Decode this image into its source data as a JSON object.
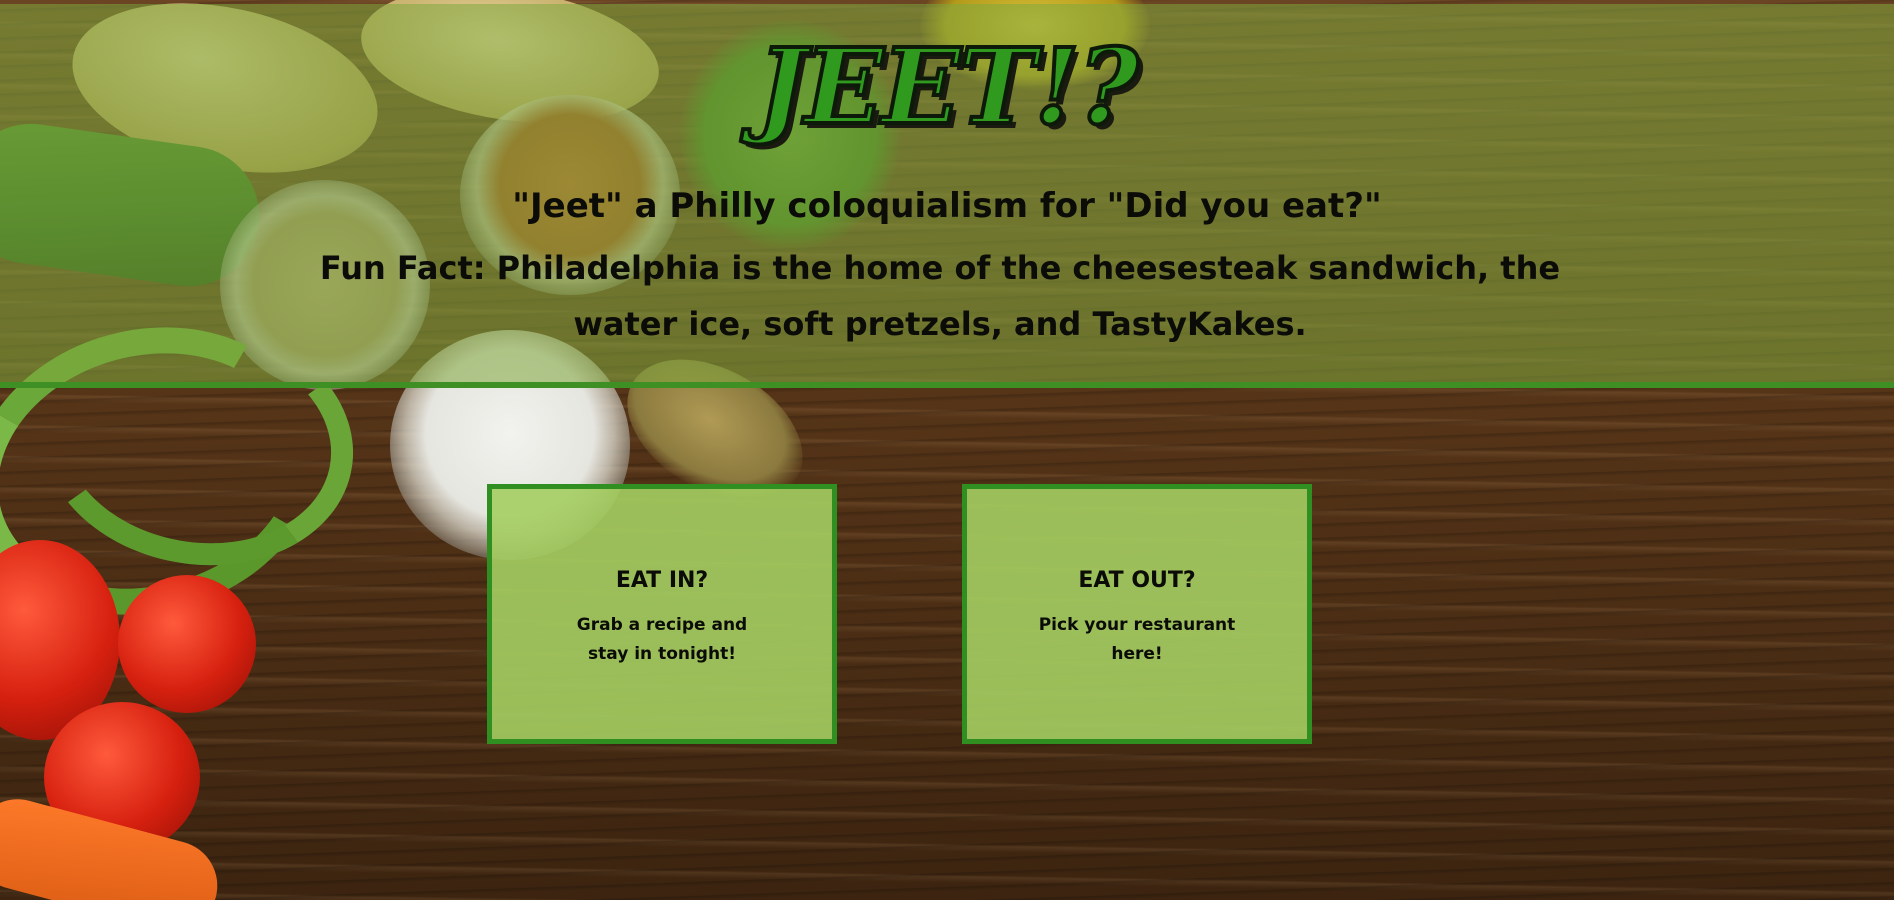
{
  "header": {
    "logo": "JEET!?",
    "subtitle": "\"Jeet\" a Philly coloquialism for \"Did you eat?\"",
    "fun_fact": "Fun Fact: Philadelphia is the home of the cheesesteak sandwich, the water ice, soft pretzels, and TastyKakes."
  },
  "cards": [
    {
      "title": "EAT IN?",
      "text": "Grab a recipe and stay in tonight!"
    },
    {
      "title": "EAT OUT?",
      "text": "Pick your restaurant here!"
    }
  ],
  "colors": {
    "accent_green": "#2f8f21",
    "card_fill": "#a4ce62",
    "header_overlay": "#80a83e"
  }
}
